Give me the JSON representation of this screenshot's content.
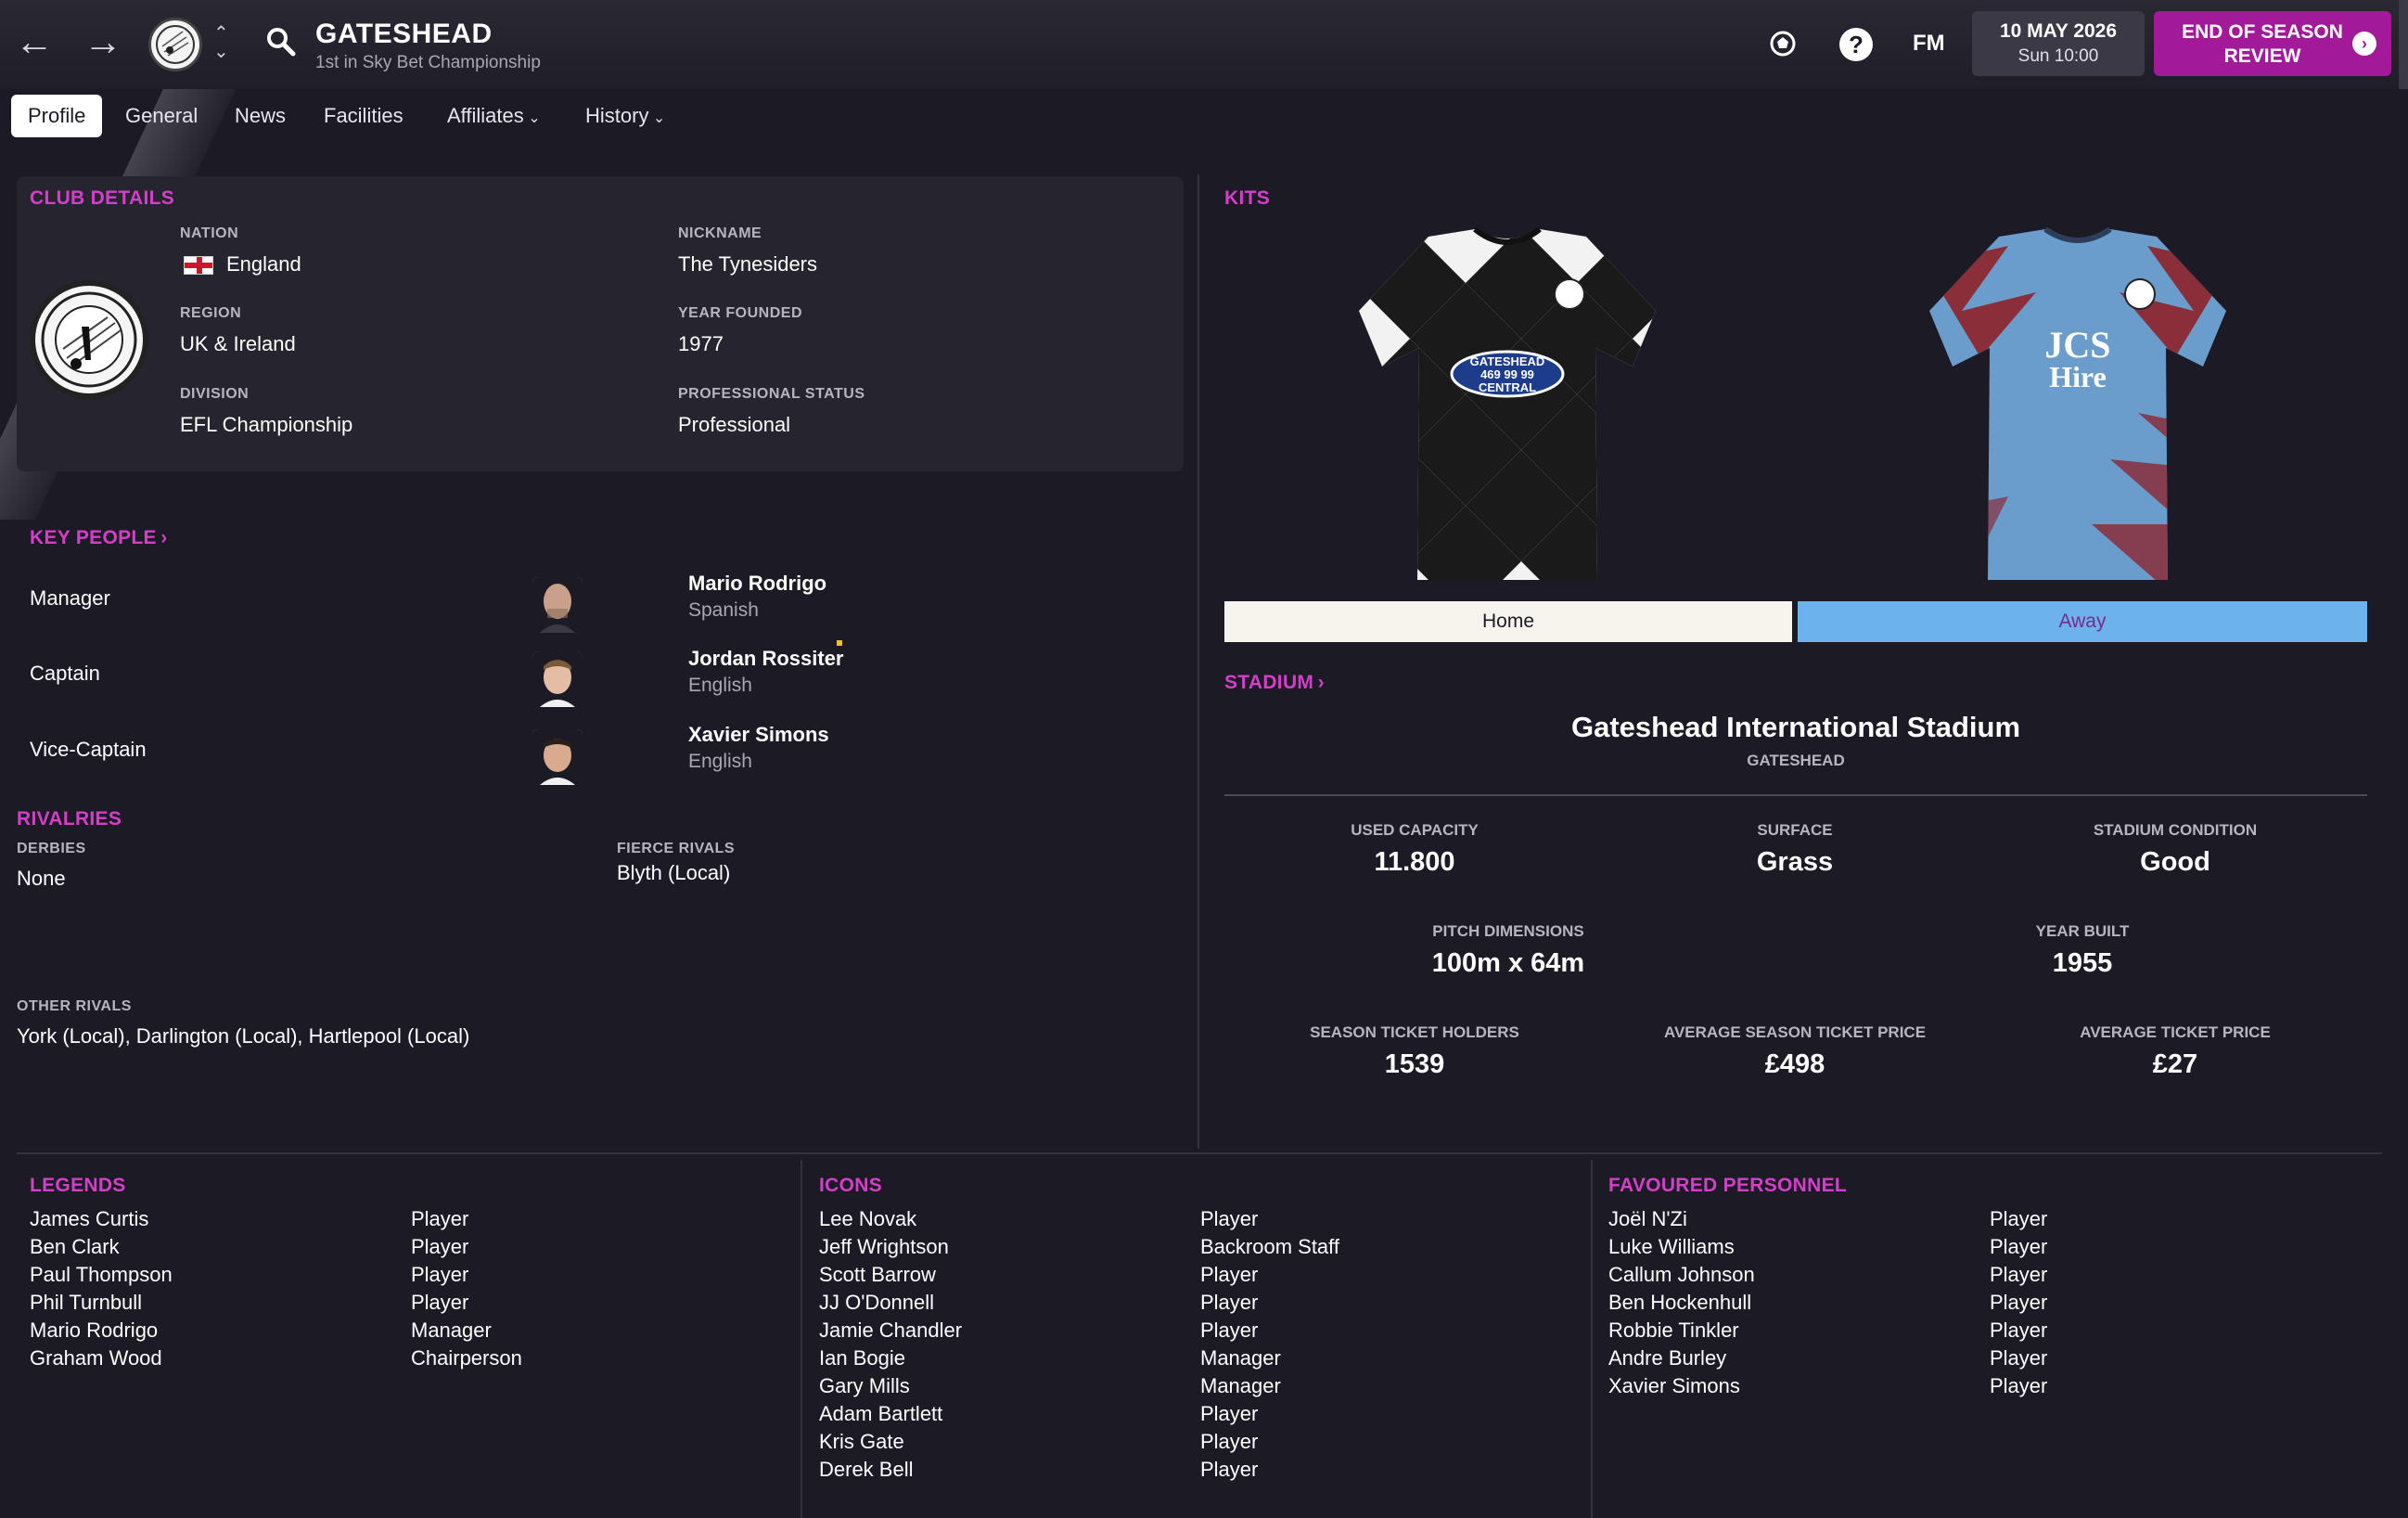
{
  "header": {
    "club_name": "GATESHEAD",
    "club_subtitle": "1st in Sky Bet Championship",
    "date_main": "10 MAY 2026",
    "date_sub": "Sun 10:00",
    "eos_line1": "END OF SEASON",
    "eos_line2": "REVIEW",
    "fm_label": "FM",
    "help_label": "?"
  },
  "tabs": [
    "Profile",
    "General",
    "News",
    "Facilities",
    "Affiliates",
    "History"
  ],
  "club_details": {
    "title": "CLUB DETAILS",
    "nation_label": "NATION",
    "nation": "England",
    "region_label": "REGION",
    "region": "UK & Ireland",
    "division_label": "DIVISION",
    "division": "EFL Championship",
    "nickname_label": "NICKNAME",
    "nickname": "The Tynesiders",
    "founded_label": "YEAR FOUNDED",
    "founded": "1977",
    "status_label": "PROFESSIONAL STATUS",
    "status": "Professional"
  },
  "key_people": {
    "title": "KEY PEOPLE",
    "people": [
      {
        "role": "Manager",
        "name": "Mario Rodrigo",
        "nationality": "Spanish"
      },
      {
        "role": "Captain",
        "name": "Jordan Rossiter",
        "nationality": "English"
      },
      {
        "role": "Vice-Captain",
        "name": "Xavier Simons",
        "nationality": "English"
      }
    ]
  },
  "rivalries": {
    "title": "RIVALRIES",
    "derbies_label": "DERBIES",
    "derbies": "None",
    "fierce_label": "FIERCE RIVALS",
    "fierce": "Blyth (Local)",
    "other_label": "OTHER RIVALS",
    "other": "York (Local), Darlington (Local), Hartlepool (Local)"
  },
  "kits": {
    "title": "KITS",
    "home_label": "Home",
    "away_label": "Away",
    "home_sponsor_lines": [
      "GATESHEAD",
      "469 99 99",
      "CENTRAL"
    ],
    "away_sponsor_lines": [
      "JCS",
      "Hire"
    ]
  },
  "stadium": {
    "title": "STADIUM",
    "name": "Gateshead International Stadium",
    "city": "GATESHEAD",
    "stats": [
      {
        "label": "USED CAPACITY",
        "value": "11.800"
      },
      {
        "label": "SURFACE",
        "value": "Grass"
      },
      {
        "label": "STADIUM CONDITION",
        "value": "Good"
      },
      {
        "label": "PITCH DIMENSIONS",
        "value": "100m x 64m"
      },
      {
        "label": "YEAR BUILT",
        "value": "1955"
      },
      {
        "label": "SEASON TICKET HOLDERS",
        "value": "1539"
      },
      {
        "label": "AVERAGE SEASON TICKET PRICE",
        "value": "£498"
      },
      {
        "label": "AVERAGE TICKET PRICE",
        "value": "£27"
      }
    ]
  },
  "legends": {
    "title": "LEGENDS",
    "items": [
      {
        "name": "James Curtis",
        "role": "Player"
      },
      {
        "name": "Ben Clark",
        "role": "Player"
      },
      {
        "name": "Paul Thompson",
        "role": "Player"
      },
      {
        "name": "Phil Turnbull",
        "role": "Player"
      },
      {
        "name": "Mario Rodrigo",
        "role": "Manager"
      },
      {
        "name": "Graham Wood",
        "role": "Chairperson"
      }
    ]
  },
  "icons": {
    "title": "ICONS",
    "items": [
      {
        "name": "Lee Novak",
        "role": "Player"
      },
      {
        "name": "Jeff Wrightson",
        "role": "Backroom Staff"
      },
      {
        "name": "Scott Barrow",
        "role": "Player"
      },
      {
        "name": "JJ O'Donnell",
        "role": "Player"
      },
      {
        "name": "Jamie Chandler",
        "role": "Player"
      },
      {
        "name": "Ian Bogie",
        "role": "Manager"
      },
      {
        "name": "Gary Mills",
        "role": "Manager"
      },
      {
        "name": "Adam Bartlett",
        "role": "Player"
      },
      {
        "name": "Kris Gate",
        "role": "Player"
      },
      {
        "name": "Derek Bell",
        "role": "Player"
      }
    ]
  },
  "favoured": {
    "title": "FAVOURED PERSONNEL",
    "items": [
      {
        "name": "Joël N'Zi",
        "role": "Player"
      },
      {
        "name": "Luke Williams",
        "role": "Player"
      },
      {
        "name": "Callum Johnson",
        "role": "Player"
      },
      {
        "name": "Ben Hockenhull",
        "role": "Player"
      },
      {
        "name": "Robbie Tinkler",
        "role": "Player"
      },
      {
        "name": "Andre Burley",
        "role": "Player"
      },
      {
        "name": "Xavier Simons",
        "role": "Player"
      }
    ]
  },
  "colors": {
    "accent": "#d43fc9",
    "eos_button": "#a21a9a",
    "away_kit_button": "#6cb2ec",
    "home_kit_button": "#f6f4ec",
    "background": "#1c1a24"
  }
}
